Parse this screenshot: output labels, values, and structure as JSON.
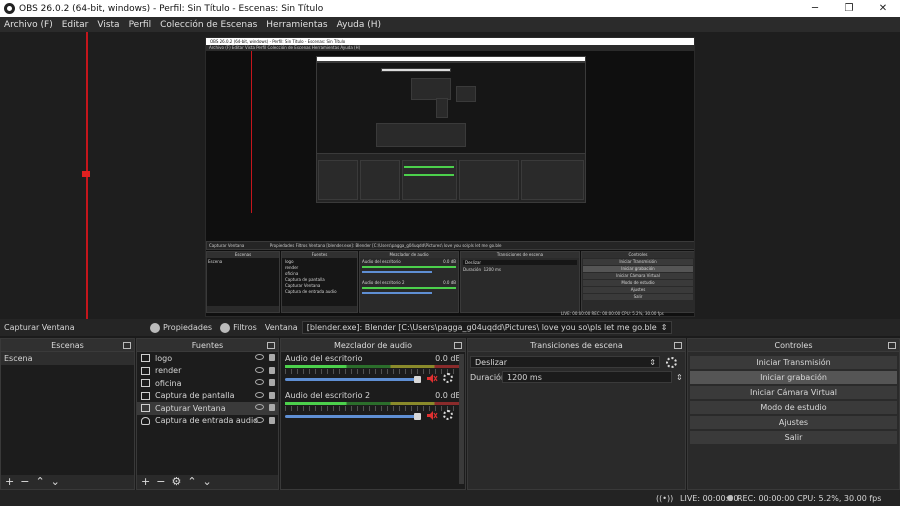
{
  "window": {
    "title": "OBS 26.0.2 (64-bit, windows) - Perfil: Sin Título - Escenas: Sin Título",
    "minimize_icon": "─",
    "maximize_icon": "❐",
    "close_icon": "✕"
  },
  "menu": [
    "Archivo (F)",
    "Editar",
    "Vista",
    "Perfil",
    "Colección de Escenas",
    "Herramientas",
    "Ayuda (H)"
  ],
  "nested_preview": {
    "title": "OBS 26.0.2 (64-bit, windows) - Perfil: Sin Título - Escenas: Sin Título",
    "menu": "Archivo (F)   Editar   Vista   Perfil   Colección de Escenas   Herramientas   Ayuda (H)",
    "source_bar": "Capturar Ventana",
    "source_bar_buttons": "Propiedades  Filtros  Ventana  [blender.exe]: Blender [C:\\Users\\pagga_g04uqdd\\Pictures\\ love you so\\pls let me go.ble",
    "headers": [
      "Escenas",
      "Fuentes",
      "Mezclador de audio",
      "Transiciones de escena",
      "Controles"
    ],
    "scene": "Escena",
    "sources": [
      "logo",
      "render",
      "oficina",
      "Captura de pantalla",
      "Capturar Ventana",
      "Captura de entrada audio"
    ],
    "mixer": [
      "Audio del escritorio",
      "Audio del escritorio 2"
    ],
    "db": "0.0 dB",
    "transition": "Deslizar",
    "duration_label": "Duración",
    "duration": "1200 ms",
    "controls": [
      "Iniciar Transmisión",
      "Iniciar grabación",
      "Iniciar Cámara Virtual",
      "Modo de estudio",
      "Ajustes",
      "Salir"
    ],
    "status": "LIVE: 00:00:00   REC: 00:00:00   CPU: 5.2%, 30.00 fps"
  },
  "source_toolbar": {
    "source_name": "Capturar Ventana",
    "properties_label": "Propiedades",
    "filters_label": "Filtros",
    "window_label": "Ventana",
    "window_value": "[blender.exe]: Blender [C:\\Users\\pagga_g04uqdd\\Pictures\\ love you so\\pls let me go.ble"
  },
  "scenes": {
    "header": "Escenas",
    "items": [
      "Escena"
    ],
    "footer": [
      "+",
      "−",
      "⌃",
      "⌄"
    ]
  },
  "sources": {
    "header": "Fuentes",
    "items": [
      {
        "label": "logo",
        "selected": false
      },
      {
        "label": "render",
        "selected": false
      },
      {
        "label": "oficina",
        "selected": false
      },
      {
        "label": "Captura de pantalla",
        "selected": false
      },
      {
        "label": "Capturar Ventana",
        "selected": true
      },
      {
        "label": "Captura de entrada audio",
        "selected": false
      }
    ],
    "footer": [
      "+",
      "−",
      "⚙",
      "⌃",
      "⌄"
    ]
  },
  "mixer": {
    "header": "Mezclador de audio",
    "channels": [
      {
        "name": "Audio del escritorio",
        "db": "0.0 dB",
        "volume": 1.0,
        "muted": true
      },
      {
        "name": "Audio del escritorio 2",
        "db": "0.0 dB",
        "volume": 1.0,
        "muted": true
      }
    ]
  },
  "transitions": {
    "header": "Transiciones de escena",
    "selected": "Deslizar",
    "duration_label": "Duración",
    "duration_value": "1200 ms"
  },
  "controls": {
    "header": "Controles",
    "buttons": [
      {
        "label": "Iniciar Transmisión",
        "active": false
      },
      {
        "label": "Iniciar grabación",
        "active": true
      },
      {
        "label": "Iniciar Cámara Virtual",
        "active": false
      },
      {
        "label": "Modo de estudio",
        "active": false
      },
      {
        "label": "Ajustes",
        "active": false
      },
      {
        "label": "Salir",
        "active": false
      }
    ]
  },
  "status": {
    "live": "LIVE: 00:00:00",
    "rec": "REC: 00:00:00",
    "cpu": "CPU: 5.2%, 30.00 fps"
  },
  "colors": {
    "accent_red": "#c4161c",
    "meter_green": "#4cd04c",
    "slider_blue": "#5f8fd4"
  }
}
